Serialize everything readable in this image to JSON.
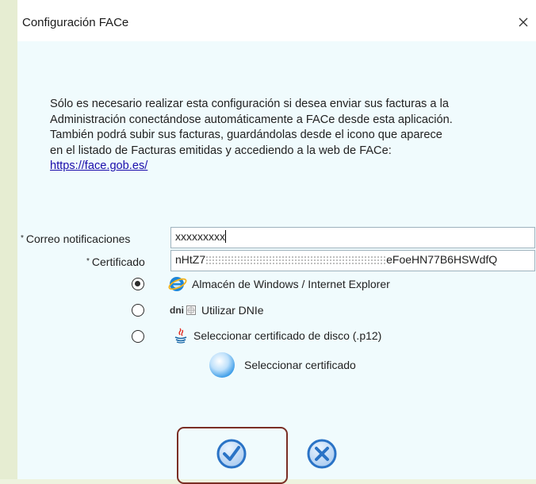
{
  "window": {
    "title": "Configuración FACe",
    "close_label": "close"
  },
  "intro": {
    "lines": [
      "Sólo es necesario realizar esta configuración si desea enviar sus facturas a la",
      "Administración conectándose automáticamente a FACe desde esta aplicación.",
      "También podrá subir sus facturas, guardándolas desde el icono que aparece",
      "en el listado de Facturas emitidas y accediendo a la web de FACe:"
    ],
    "link": "https://face.gob.es/"
  },
  "form": {
    "required_mark": "*",
    "email_label": "Correo notificaciones",
    "email_value": "xxxxxxxxx",
    "cert_label": "Certificado",
    "cert_value_start": "nHtZ7",
    "cert_value_end": "eFoeHN77B6HSWdfQ"
  },
  "options": [
    {
      "label": "Almacén de Windows / Internet Explorer",
      "icon": "internet-explorer-icon",
      "selected": true
    },
    {
      "label": "Utilizar DNIe",
      "icon": "dnie-icon",
      "icon_text": "dni",
      "selected": false
    },
    {
      "label": "Seleccionar certificado de disco (.p12)",
      "icon": "java-icon",
      "selected": false
    }
  ],
  "select_certificate": {
    "label": "Seleccionar certificado",
    "icon": "blue-sphere-icon"
  },
  "buttons": {
    "accept_icon": "checkmark-circle-icon",
    "cancel_icon": "x-circle-icon"
  },
  "colors": {
    "dialog_bg": "#f0fbfd",
    "link": "#1a0dab",
    "button_blue": "#2a73c6",
    "highlight_frame": "#7a2e25"
  }
}
